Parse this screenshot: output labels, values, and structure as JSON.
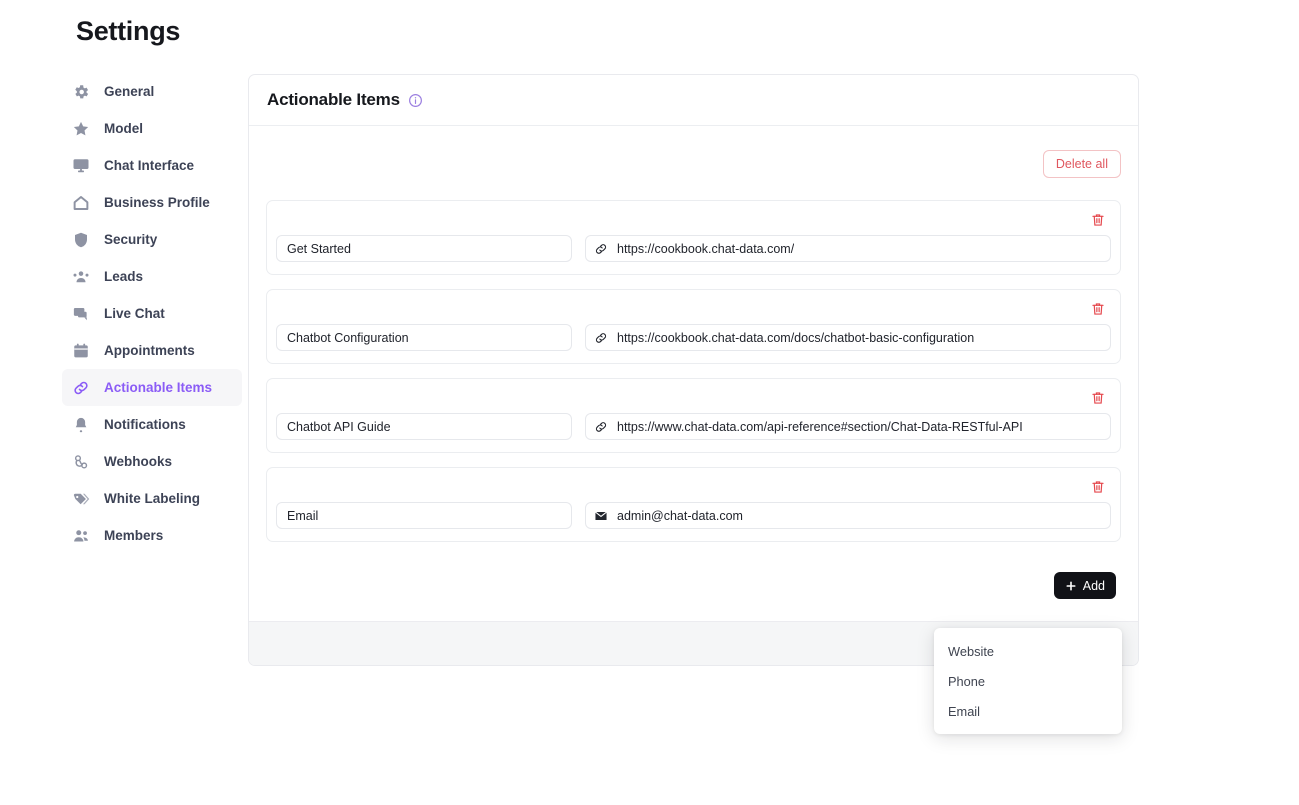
{
  "page": {
    "title": "Settings"
  },
  "sidebar": {
    "items": [
      {
        "label": "General",
        "icon": "gear-icon",
        "active": false
      },
      {
        "label": "Model",
        "icon": "star-icon",
        "active": false
      },
      {
        "label": "Chat Interface",
        "icon": "monitor-icon",
        "active": false
      },
      {
        "label": "Business Profile",
        "icon": "home-icon",
        "active": false
      },
      {
        "label": "Security",
        "icon": "shield-icon",
        "active": false
      },
      {
        "label": "Leads",
        "icon": "people-icon",
        "active": false
      },
      {
        "label": "Live Chat",
        "icon": "chat-bubble-icon",
        "active": false
      },
      {
        "label": "Appointments",
        "icon": "calendar-icon",
        "active": false
      },
      {
        "label": "Actionable Items",
        "icon": "link-icon",
        "active": true
      },
      {
        "label": "Notifications",
        "icon": "bell-icon",
        "active": false
      },
      {
        "label": "Webhooks",
        "icon": "webhook-icon",
        "active": false
      },
      {
        "label": "White Labeling",
        "icon": "tag-icon",
        "active": false
      },
      {
        "label": "Members",
        "icon": "members-icon",
        "active": false
      }
    ]
  },
  "main": {
    "card_title": "Actionable Items",
    "info_icon": "info-circle-icon",
    "delete_all_label": "Delete all",
    "add_label": "Add",
    "add_icon": "plus-icon",
    "trash_icon": "trash-icon",
    "items": [
      {
        "label": "Get Started",
        "value": "https://cookbook.chat-data.com/",
        "icon": "link-icon",
        "type": "Website"
      },
      {
        "label": "Chatbot Configuration",
        "value": "https://cookbook.chat-data.com/docs/chatbot-basic-configuration",
        "icon": "link-icon",
        "type": "Website"
      },
      {
        "label": "Chatbot API Guide",
        "value": "https://www.chat-data.com/api-reference#section/Chat-Data-RESTful-API",
        "icon": "link-icon",
        "type": "Website"
      },
      {
        "label": "Email",
        "value": "admin@chat-data.com",
        "icon": "envelope-icon",
        "type": "Email"
      }
    ]
  },
  "dropdown": {
    "options": [
      {
        "label": "Website"
      },
      {
        "label": "Phone"
      },
      {
        "label": "Email"
      }
    ]
  },
  "colors": {
    "accent": "#8b5cf6",
    "danger": "#e5484d",
    "delete_all_border": "#f3c3c5",
    "add_button_bg": "#111217",
    "footer_bg": "#f5f6f7"
  }
}
